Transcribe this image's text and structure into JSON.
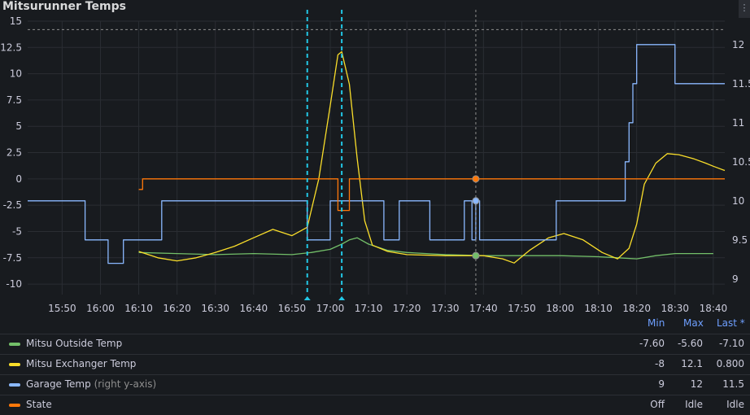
{
  "panel": {
    "title": "Mitsurunner Temps",
    "menu_icon": "ellipsis-vertical-icon"
  },
  "legend": {
    "headers": {
      "min": "Min",
      "max": "Max",
      "last": "Last *"
    },
    "rows": [
      {
        "name": "Mitsu Outside Temp",
        "note": "",
        "color": "#73bf69",
        "min": "-7.60",
        "max": "-5.60",
        "last": "-7.10"
      },
      {
        "name": "Mitsu Exchanger Temp",
        "note": "",
        "color": "#fade2a",
        "min": "-8",
        "max": "12.1",
        "last": "0.800"
      },
      {
        "name": "Garage Temp",
        "note": "(right y-axis)",
        "color": "#8ab8ff",
        "min": "9",
        "max": "12",
        "last": "11.5"
      },
      {
        "name": "State",
        "note": "",
        "color": "#ff780a",
        "min": "Off",
        "max": "Idle",
        "last": "Idle"
      }
    ]
  },
  "chart_data": {
    "type": "line",
    "title": "Mitsurunner Temps",
    "x_ticks": [
      "15:50",
      "16:00",
      "16:10",
      "16:20",
      "16:30",
      "16:40",
      "16:50",
      "17:00",
      "17:10",
      "17:20",
      "17:30",
      "17:40",
      "17:50",
      "18:00",
      "18:10",
      "18:20",
      "18:30",
      "18:40"
    ],
    "x_range": [
      "15:41",
      "18:43"
    ],
    "y_left": {
      "ticks": [
        "15",
        "12.5",
        "10",
        "7.5",
        "5",
        "2.5",
        "0",
        "-2.5",
        "-5",
        "-7.5",
        "-10"
      ],
      "range": [
        -11,
        15
      ]
    },
    "y_right": {
      "ticks": [
        "12",
        "11.5",
        "11",
        "10.5",
        "10",
        "9.5",
        "9"
      ],
      "range": [
        8.8,
        12.3
      ]
    },
    "threshold_left": 14.2,
    "annotations": [
      "16:54",
      "17:03"
    ],
    "cursor_time": "17:38",
    "grid": true,
    "series": [
      {
        "name": "Mitsu Outside Temp",
        "color": "#73bf69",
        "axis": "left",
        "points": [
          [
            "16:10",
            -7
          ],
          [
            "16:20",
            -7.1
          ],
          [
            "16:30",
            -7.2
          ],
          [
            "16:40",
            -7.1
          ],
          [
            "16:50",
            -7.2
          ],
          [
            "16:55",
            -7
          ],
          [
            "17:00",
            -6.7
          ],
          [
            "17:03",
            -6.2
          ],
          [
            "17:05",
            -5.8
          ],
          [
            "17:07",
            -5.6
          ],
          [
            "17:10",
            -6.2
          ],
          [
            "17:15",
            -6.8
          ],
          [
            "17:20",
            -7
          ],
          [
            "17:30",
            -7.2
          ],
          [
            "17:40",
            -7.3
          ],
          [
            "17:50",
            -7.3
          ],
          [
            "18:00",
            -7.3
          ],
          [
            "18:10",
            -7.4
          ],
          [
            "18:15",
            -7.5
          ],
          [
            "18:20",
            -7.6
          ],
          [
            "18:25",
            -7.3
          ],
          [
            "18:30",
            -7.1
          ],
          [
            "18:40",
            -7.1
          ]
        ]
      },
      {
        "name": "Mitsu Exchanger Temp",
        "color": "#fade2a",
        "axis": "left",
        "points": [
          [
            "16:10",
            -6.9
          ],
          [
            "16:15",
            -7.5
          ],
          [
            "16:20",
            -7.8
          ],
          [
            "16:25",
            -7.5
          ],
          [
            "16:30",
            -7
          ],
          [
            "16:35",
            -6.4
          ],
          [
            "16:40",
            -5.6
          ],
          [
            "16:45",
            -4.8
          ],
          [
            "16:50",
            -5.4
          ],
          [
            "16:54",
            -4.6
          ],
          [
            "16:57",
            0
          ],
          [
            "17:00",
            7
          ],
          [
            "17:02",
            11.8
          ],
          [
            "17:03",
            12.1
          ],
          [
            "17:05",
            9
          ],
          [
            "17:07",
            2
          ],
          [
            "17:09",
            -4
          ],
          [
            "17:11",
            -6.3
          ],
          [
            "17:15",
            -6.9
          ],
          [
            "17:20",
            -7.2
          ],
          [
            "17:30",
            -7.3
          ],
          [
            "17:40",
            -7.3
          ],
          [
            "17:45",
            -7.6
          ],
          [
            "17:48",
            -8
          ],
          [
            "17:52",
            -6.8
          ],
          [
            "17:57",
            -5.6
          ],
          [
            "18:01",
            -5.2
          ],
          [
            "18:06",
            -5.8
          ],
          [
            "18:11",
            -7
          ],
          [
            "18:15",
            -7.6
          ],
          [
            "18:18",
            -6.6
          ],
          [
            "18:20",
            -4.3
          ],
          [
            "18:22",
            -0.5
          ],
          [
            "18:25",
            1.5
          ],
          [
            "18:28",
            2.4
          ],
          [
            "18:31",
            2.3
          ],
          [
            "18:35",
            1.9
          ],
          [
            "18:38",
            1.5
          ],
          [
            "18:40",
            1.2
          ],
          [
            "18:43",
            0.8
          ]
        ]
      },
      {
        "name": "Garage Temp",
        "color": "#8ab8ff",
        "axis": "right",
        "points": [
          [
            "15:41",
            10
          ],
          [
            "15:56",
            10
          ],
          [
            "15:56",
            9.5
          ],
          [
            "16:02",
            9.5
          ],
          [
            "16:02",
            9.2
          ],
          [
            "16:06",
            9.2
          ],
          [
            "16:06",
            9.5
          ],
          [
            "16:16",
            9.5
          ],
          [
            "16:16",
            10
          ],
          [
            "16:54",
            10
          ],
          [
            "16:54",
            9.5
          ],
          [
            "17:00",
            9.5
          ],
          [
            "17:00",
            10
          ],
          [
            "17:14",
            10
          ],
          [
            "17:14",
            9.5
          ],
          [
            "17:18",
            9.5
          ],
          [
            "17:18",
            10
          ],
          [
            "17:26",
            10
          ],
          [
            "17:26",
            9.5
          ],
          [
            "17:35",
            9.5
          ],
          [
            "17:35",
            10
          ],
          [
            "17:37",
            10
          ],
          [
            "17:37",
            9.5
          ],
          [
            "17:38",
            9.5
          ],
          [
            "17:38",
            10
          ],
          [
            "17:39",
            10
          ],
          [
            "17:39",
            9.5
          ],
          [
            "17:59",
            9.5
          ],
          [
            "17:59",
            10
          ],
          [
            "18:17",
            10
          ],
          [
            "18:17",
            10.5
          ],
          [
            "18:18",
            10.5
          ],
          [
            "18:18",
            11
          ],
          [
            "18:19",
            11
          ],
          [
            "18:19",
            11.5
          ],
          [
            "18:20",
            11.5
          ],
          [
            "18:20",
            12
          ],
          [
            "18:30",
            12
          ],
          [
            "18:30",
            11.5
          ],
          [
            "18:43",
            11.5
          ]
        ]
      },
      {
        "name": "State",
        "color": "#ff780a",
        "axis": "left",
        "points": [
          [
            "16:10",
            -1
          ],
          [
            "16:11",
            -1
          ],
          [
            "16:11",
            0
          ],
          [
            "17:02",
            0
          ],
          [
            "17:02",
            -3
          ],
          [
            "17:05",
            -3
          ],
          [
            "17:05",
            0
          ],
          [
            "18:43",
            0
          ]
        ]
      }
    ],
    "cursor_markers": [
      {
        "series": "State",
        "value": 0,
        "color": "#ff780a"
      },
      {
        "series": "Garage Temp",
        "value": 10,
        "color": "#8ab8ff"
      },
      {
        "series": "Mitsu Exchanger Temp",
        "value": -7.3,
        "color": "#fade2a"
      },
      {
        "series": "Mitsu Outside Temp",
        "value": -7.3,
        "color": "#73bf69"
      }
    ]
  }
}
